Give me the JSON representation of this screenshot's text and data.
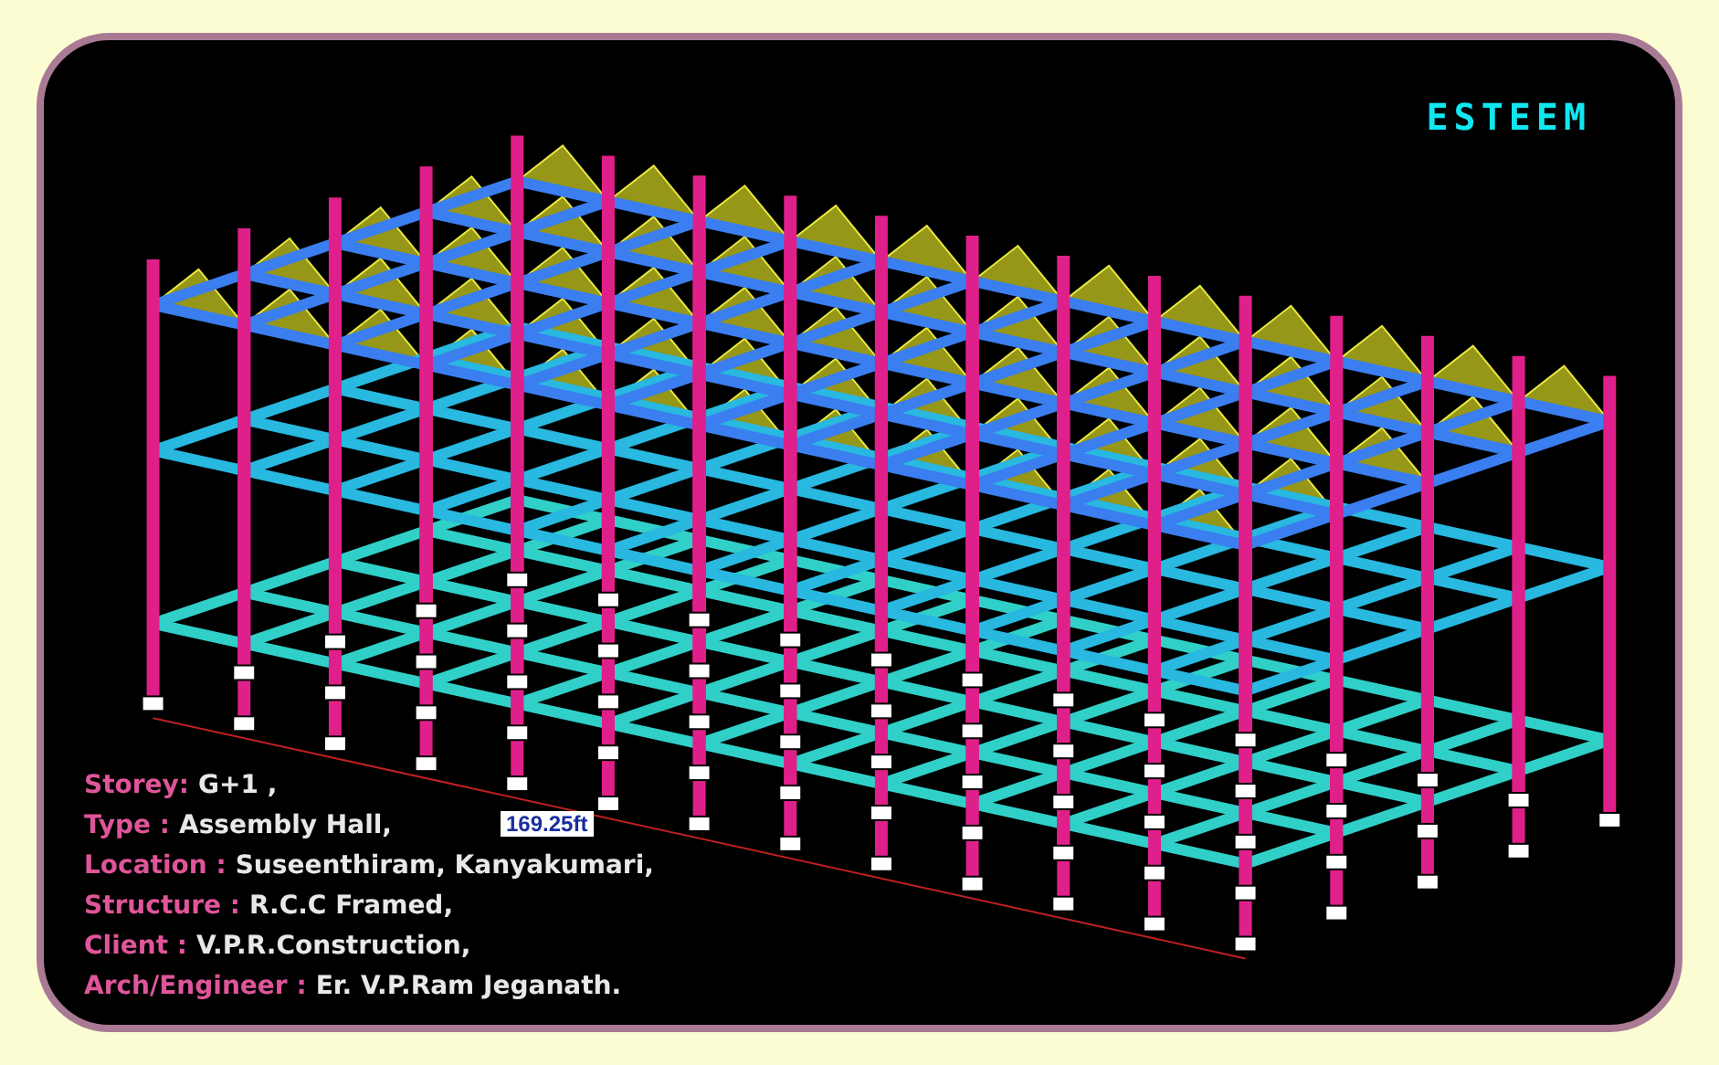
{
  "logo": "ESTEEM",
  "dimension_label": "169.25ft",
  "info_lines": [
    {
      "label": "Storey:",
      "value": "G+1 ,"
    },
    {
      "label": "Type :",
      "value": "Assembly Hall,"
    },
    {
      "label": "Location :",
      "value": "Suseenthiram, Kanyakumari,"
    },
    {
      "label": "Structure :",
      "value": "R.C.C Framed,"
    },
    {
      "label": "Client :",
      "value": "V.P.R.Construction,"
    },
    {
      "label": "Arch/Engineer :",
      "value": "Er. V.P.Ram Jeganath."
    }
  ]
}
